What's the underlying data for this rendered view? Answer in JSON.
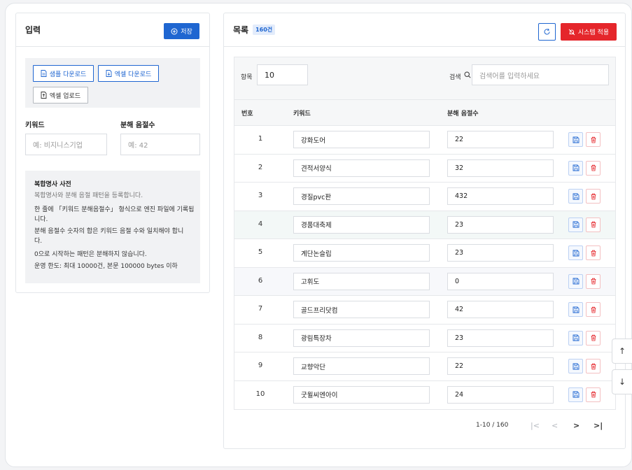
{
  "left_panel": {
    "title": "입력",
    "save_label": "저장",
    "sample_download_label": "샘플 다운로드",
    "excel_download_label": "엑셀 다운로드",
    "excel_upload_label": "엑셀 업로드",
    "keyword_label": "키워드",
    "syllable_label": "분해 음절수",
    "keyword_placeholder": "예: 비지니스기업",
    "syllable_placeholder": "예: 42",
    "dict_title": "복합명사 사전",
    "dict_subtitle": "복합명사와 분해 음절 패턴을 등록합니다.",
    "dict_lines": [
      "한 줄에 「키워드 분해음절수」 형식으로 엔진 파일에 기록됩",
      "니다.",
      "분해 음절수 숫자의 합은 키워드 음절 수와 일치해야 합니",
      "다.",
      "0으로 시작하는 패턴은 분해하지 않습니다.",
      "운영 한도: 최대 10000건, 본문 100000 bytes 이하"
    ]
  },
  "right_panel": {
    "title": "목록",
    "count_badge": "160건",
    "apply_label": "시스템 적용",
    "items_label": "항목",
    "items_value": "10",
    "search_label": "검색",
    "search_placeholder": "검색어를 입력하세요",
    "columns": [
      "번호",
      "키워드",
      "분해 음절수"
    ],
    "rows": [
      {
        "no": "1",
        "keyword": "강화도어",
        "syllables": "22"
      },
      {
        "no": "2",
        "keyword": "견적서양식",
        "syllables": "32"
      },
      {
        "no": "3",
        "keyword": "경질pvc판",
        "syllables": "432"
      },
      {
        "no": "4",
        "keyword": "경품대축제",
        "syllables": "23"
      },
      {
        "no": "5",
        "keyword": "계단논슬립",
        "syllables": "23"
      },
      {
        "no": "6",
        "keyword": "고휘도",
        "syllables": "0"
      },
      {
        "no": "7",
        "keyword": "골드프리닷컴",
        "syllables": "42"
      },
      {
        "no": "8",
        "keyword": "광림특장차",
        "syllables": "23"
      },
      {
        "no": "9",
        "keyword": "교향악단",
        "syllables": "22"
      },
      {
        "no": "10",
        "keyword": "굿윌씨엔아이",
        "syllables": "24"
      }
    ],
    "pagination": {
      "range": "1-10 / 160",
      "first": "|<",
      "prev": "<",
      "next": ">",
      "last": ">|"
    }
  },
  "side_buttons": {
    "up": "↑",
    "down": "↓"
  },
  "colors": {
    "primary": "#1f66d1",
    "danger": "#e5262b",
    "hover_row": "#f3f8f7"
  }
}
